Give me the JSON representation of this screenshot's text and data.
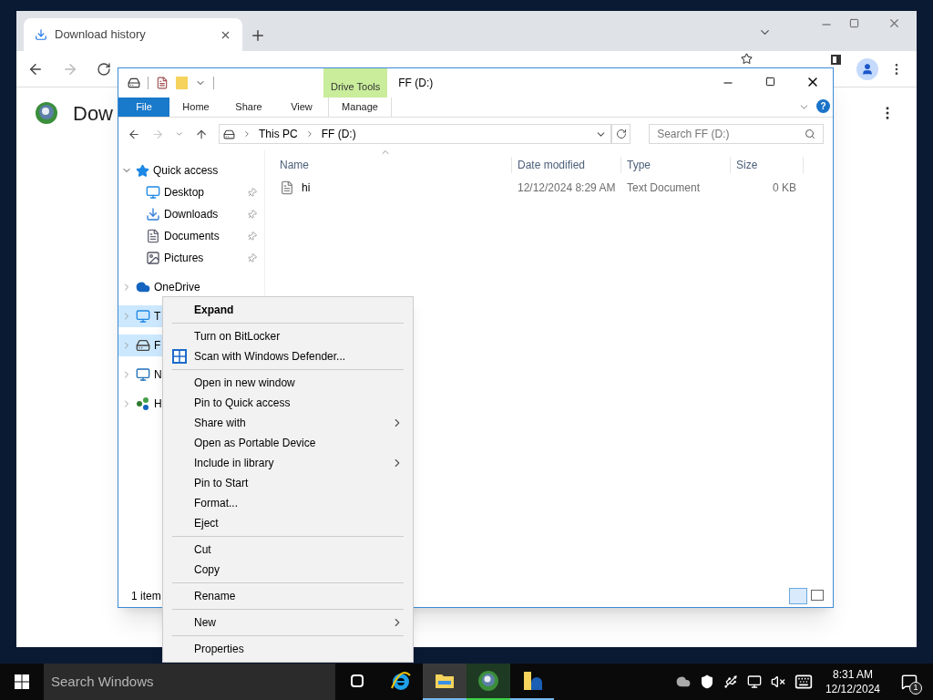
{
  "browser": {
    "tab": {
      "title": "Download history"
    },
    "page_heading": "Dow"
  },
  "explorer": {
    "title": "FF (D:)",
    "context_tab_group": "Drive Tools",
    "ribbon_tabs": [
      {
        "label": "File",
        "selected": true
      },
      {
        "label": "Home",
        "selected": false
      },
      {
        "label": "Share",
        "selected": false
      },
      {
        "label": "View",
        "selected": false
      },
      {
        "label": "Manage",
        "selected": false
      }
    ],
    "breadcrumb": [
      "This PC",
      "FF (D:)"
    ],
    "search": {
      "placeholder": "Search FF (D:)"
    },
    "nav": [
      {
        "label": "Quick access",
        "kind": "group",
        "expanded": true,
        "selected": false,
        "children": [
          {
            "label": "Desktop",
            "kind": "desktop",
            "pinned": true
          },
          {
            "label": "Downloads",
            "kind": "downloads",
            "pinned": true
          },
          {
            "label": "Documents",
            "kind": "documents",
            "pinned": true
          },
          {
            "label": "Pictures",
            "kind": "pictures",
            "pinned": true
          }
        ]
      },
      {
        "label": "OneDrive",
        "kind": "cloud",
        "expanded": false,
        "selected": false
      },
      {
        "label": "T",
        "kind": "pc",
        "expanded": false,
        "selected": true
      },
      {
        "label": "F",
        "kind": "drive",
        "expanded": false,
        "selected": true
      },
      {
        "label": "N",
        "kind": "network",
        "expanded": false,
        "selected": false
      },
      {
        "label": "H",
        "kind": "homegroup",
        "expanded": false,
        "selected": false
      }
    ],
    "columns": [
      "Name",
      "Date modified",
      "Type",
      "Size"
    ],
    "files": [
      {
        "name": "hi",
        "date": "12/12/2024 8:29 AM",
        "type": "Text Document",
        "size": "0 KB"
      }
    ],
    "status": "1 item",
    "help": "?"
  },
  "context_menu": [
    {
      "kind": "item",
      "label": "Expand",
      "default": true,
      "submenu": false
    },
    {
      "kind": "separator"
    },
    {
      "kind": "item",
      "label": "Turn on BitLocker",
      "default": false,
      "submenu": false
    },
    {
      "kind": "icon_item",
      "label": "Scan with Windows Defender...",
      "default": false,
      "submenu": false
    },
    {
      "kind": "separator"
    },
    {
      "kind": "item",
      "label": "Open in new window",
      "default": false,
      "submenu": false
    },
    {
      "kind": "item",
      "label": "Pin to Quick access",
      "default": false,
      "submenu": false
    },
    {
      "kind": "item",
      "label": "Share with",
      "default": false,
      "submenu": true
    },
    {
      "kind": "item",
      "label": "Open as Portable Device",
      "default": false,
      "submenu": false
    },
    {
      "kind": "item",
      "label": "Include in library",
      "default": false,
      "submenu": true
    },
    {
      "kind": "item",
      "label": "Pin to Start",
      "default": false,
      "submenu": false
    },
    {
      "kind": "item",
      "label": "Format...",
      "default": false,
      "submenu": false
    },
    {
      "kind": "item",
      "label": "Eject",
      "default": false,
      "submenu": false
    },
    {
      "kind": "separator"
    },
    {
      "kind": "item",
      "label": "Cut",
      "default": false,
      "submenu": false
    },
    {
      "kind": "item",
      "label": "Copy",
      "default": false,
      "submenu": false
    },
    {
      "kind": "separator"
    },
    {
      "kind": "item",
      "label": "Rename",
      "default": false,
      "submenu": false
    },
    {
      "kind": "separator"
    },
    {
      "kind": "item",
      "label": "New",
      "default": false,
      "submenu": true
    },
    {
      "kind": "separator"
    },
    {
      "kind": "item",
      "label": "Properties",
      "default": false,
      "submenu": false
    }
  ],
  "taskbar": {
    "search": {
      "placeholder": "Search Windows"
    },
    "apps": [
      {
        "kind": "taskview",
        "active": false,
        "running": false
      },
      {
        "kind": "ie",
        "active": false,
        "running": false
      },
      {
        "kind": "explorer",
        "active": true,
        "running": true
      },
      {
        "kind": "browser",
        "active": false,
        "running": true
      },
      {
        "kind": "folder",
        "active": false,
        "running": true
      }
    ],
    "time": "8:31 AM",
    "date": "12/12/2024",
    "notifications": "1"
  }
}
